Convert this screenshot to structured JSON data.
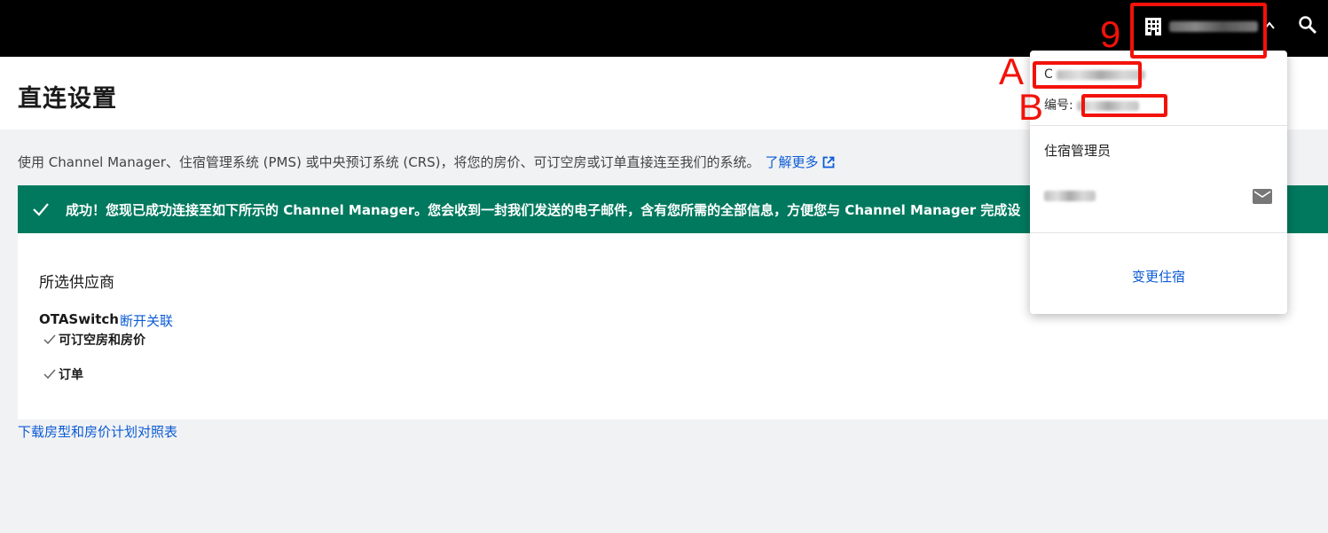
{
  "page": {
    "title": "直连设置"
  },
  "description": {
    "text": "使用 Channel Manager、住宿管理系统 (PMS) 或中央预订系统 (CRS)，将您的房价、可订空房或订单直接连至我们的系统。",
    "learn_more": "了解更多"
  },
  "banner": {
    "message": "成功！您现已成功连接至如下所示的 Channel Manager。您会收到一封我们发送的电子邮件，含有您所需的全部信息，方便您与 Channel Manager 完成设"
  },
  "provider_section": {
    "title": "所选供应商",
    "provider_name": "OTASwitch",
    "disconnect_label": "断开关联",
    "features": [
      "可订空房和房价",
      "订单"
    ]
  },
  "download_link": "下载房型和房价计划对照表",
  "dropdown": {
    "property_name_initial": "C",
    "id_label": "编号:",
    "role": "住宿管理员",
    "change_property": "变更住宿"
  },
  "annotations": {
    "top": "9",
    "a": "A",
    "b": "B"
  },
  "icons": [
    "building-icon",
    "chevron-up-icon",
    "search-icon",
    "external-link-icon",
    "check-icon",
    "mail-icon"
  ],
  "colors": {
    "banner": "#00795e",
    "link": "#0a5bd5",
    "annotation": "#f2120a",
    "topbar": "#000000"
  }
}
